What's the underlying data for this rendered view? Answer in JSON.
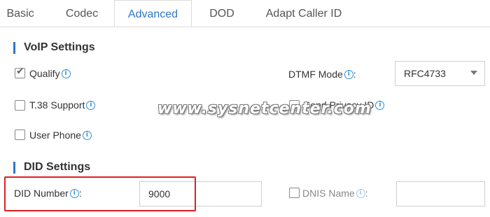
{
  "tabs": [
    {
      "label": "Basic"
    },
    {
      "label": "Codec"
    },
    {
      "label": "Advanced",
      "active": true
    },
    {
      "label": "DOD"
    },
    {
      "label": "Adapt Caller ID"
    }
  ],
  "voip": {
    "title": "VoIP Settings",
    "qualify": {
      "label": "Qualify",
      "checked": true
    },
    "t38": {
      "label": "T.38 Support",
      "checked": false
    },
    "user_phone": {
      "label": "User Phone",
      "checked": false
    },
    "dtmf": {
      "label": "DTMF Mode",
      "colon": ":",
      "value": "RFC4733"
    },
    "privacy": {
      "label": "Send Privacy ID",
      "checked": false
    }
  },
  "did": {
    "title": "DID Settings",
    "number": {
      "label": "DID Number",
      "colon": ":",
      "value": "9000"
    },
    "dnis": {
      "label": "DNIS Name",
      "colon": ":",
      "checked": false,
      "value": ""
    }
  },
  "watermark": "www.sysnetcenter.com",
  "colors": {
    "accent": "#2f78c4",
    "highlight": "#e02020",
    "info": "#2f8fd8"
  }
}
